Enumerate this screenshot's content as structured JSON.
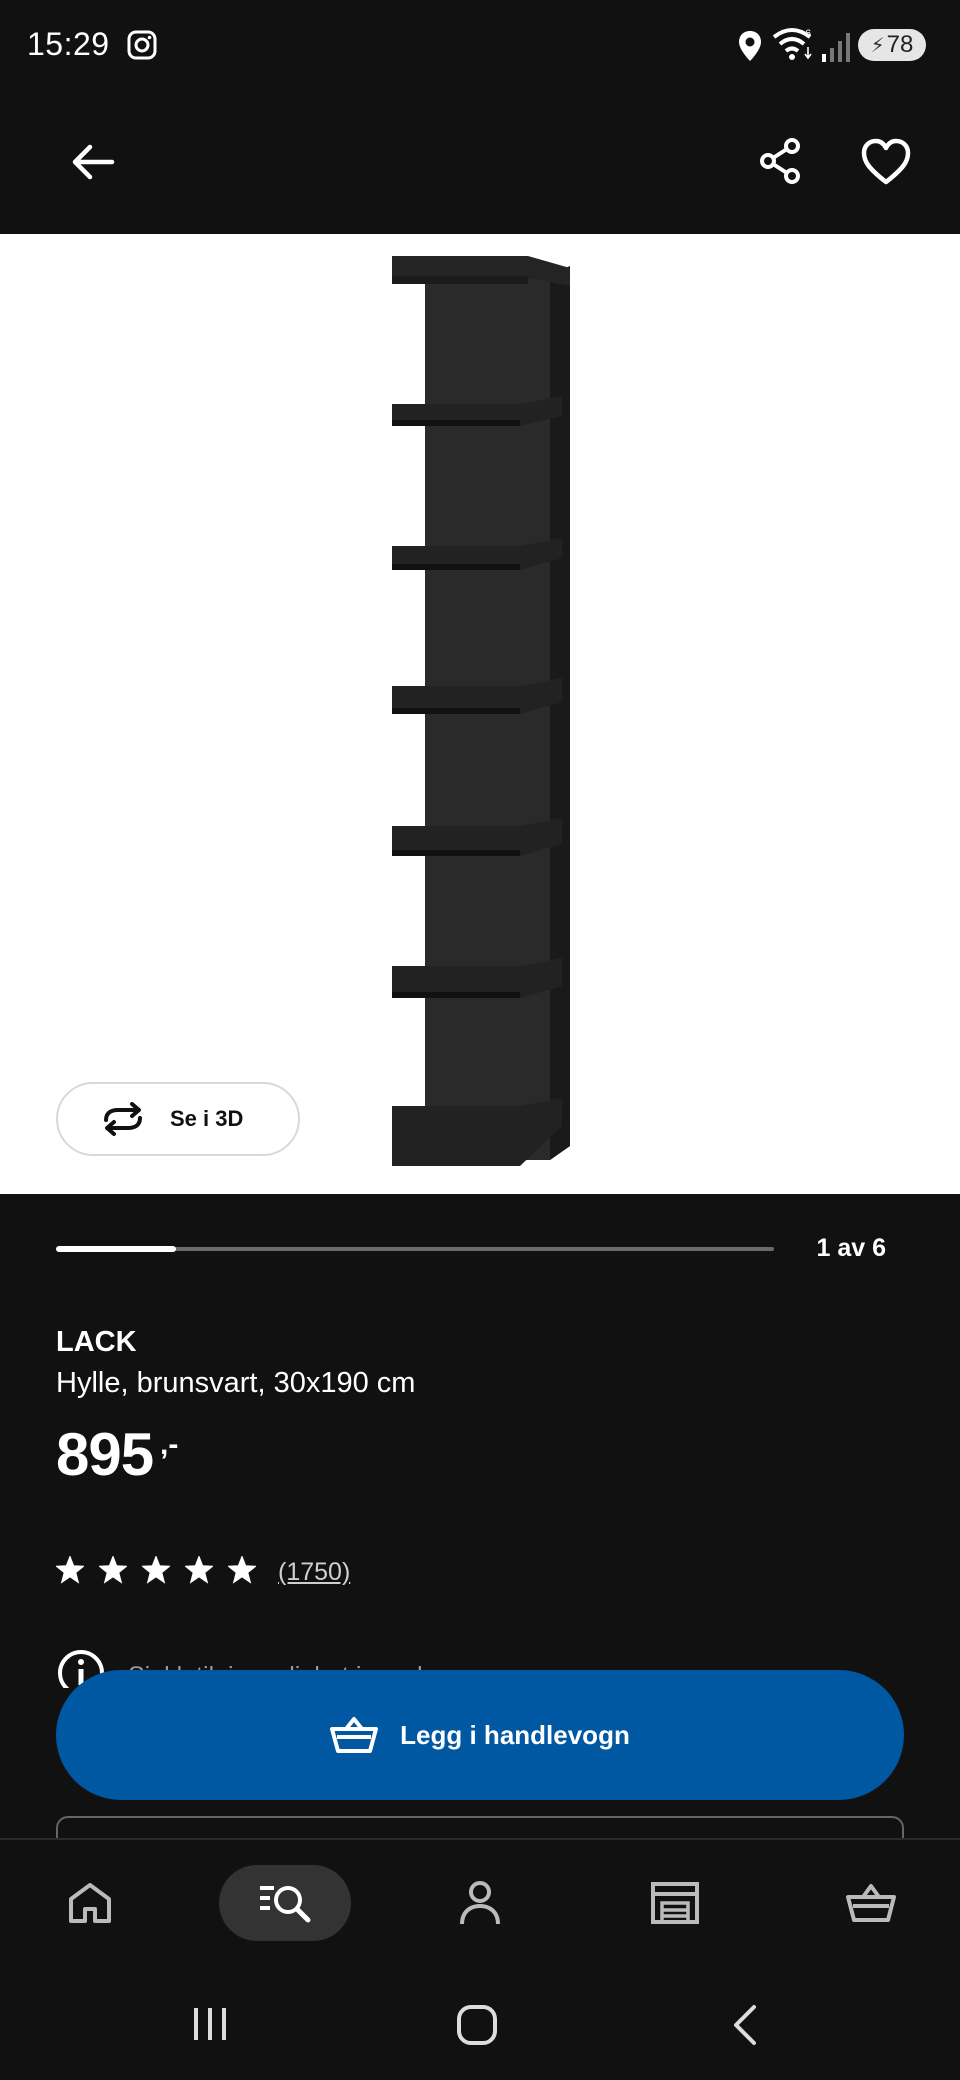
{
  "status_bar": {
    "time": "15:29",
    "battery_level": "78",
    "icons": [
      "instagram-icon",
      "location-icon",
      "wifi-icon",
      "signal-icon",
      "battery-icon"
    ]
  },
  "header": {
    "icons": [
      "arrow-left-icon",
      "share-icon",
      "heart-icon"
    ]
  },
  "gallery": {
    "view_3d_label": "Se i 3D",
    "counter": "1 av 6",
    "current": 1,
    "total": 6,
    "progress_fraction": 0.1667
  },
  "product": {
    "name": "LACK",
    "description": "Hylle, brunsvart, 30x190 cm",
    "price": "895",
    "price_suffix": ",-",
    "rating_stars": 5,
    "review_count": "(1750)",
    "info_text": "Sjekk tilgjengelighet i varehus"
  },
  "actions": {
    "add_to_cart_label": "Legg i handlevogn"
  },
  "bottom_nav": {
    "items": [
      "home-icon",
      "search-icon",
      "profile-icon",
      "stores-icon",
      "cart-icon"
    ],
    "active": "search-icon"
  },
  "colors": {
    "background": "#111111",
    "primary_button": "#0058a3",
    "image_background": "#ffffff",
    "active_nav_pill": "#333333"
  }
}
